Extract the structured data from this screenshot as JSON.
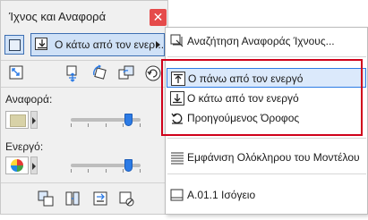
{
  "window": {
    "title": "Ίχνος και Αναφορά",
    "close_glyph": "✕"
  },
  "toolbar": {
    "reference_select_label": "Ο κάτω από τον ενερ..."
  },
  "reference": {
    "label": "Αναφορά:",
    "swatch_color": "#d8d2a8",
    "intensity": 0.85
  },
  "active": {
    "label": "Ενεργό:",
    "intensity": 0.85
  },
  "menu": {
    "items": [
      {
        "label": "Αναζήτηση Αναφοράς Ίχνους...",
        "icon": "find-reference-icon"
      },
      {
        "label": "Ο πάνω από τον ενεργό",
        "icon": "arrow-up-to-line-icon",
        "highlighted": true
      },
      {
        "label": "Ο κάτω από τον ενεργό",
        "icon": "arrow-down-to-line-icon"
      },
      {
        "label": "Προηγούμενος Όροφος",
        "icon": "previous-floor-icon"
      },
      {
        "label": "Εμφάνιση Ολόκληρου του Μοντέλου",
        "icon": "show-whole-model-icon"
      },
      {
        "label": "A.01.1 Ισόγειο",
        "icon": "floor-plan-icon"
      }
    ]
  },
  "colors": {
    "accent": "#2c7be5",
    "selection_fill": "#cfe1f7",
    "annotation_border": "#d0021b",
    "close_button": "#e54b4b"
  }
}
